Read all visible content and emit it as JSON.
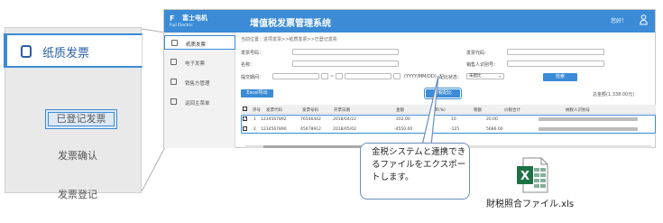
{
  "zoom": {
    "active_label": "纸质发票",
    "sub_items": [
      "已登记发票",
      "发票确认",
      "发票登记"
    ]
  },
  "app": {
    "logo_cn": "富士电机",
    "logo_en": "Fuji Electric",
    "title": "增值税发票管理系统",
    "greeting": "您好！"
  },
  "sidebar": {
    "items": [
      {
        "label": "纸质发票",
        "icon": "document-icon"
      },
      {
        "label": "电子发票",
        "icon": "image-icon"
      },
      {
        "label": "销售方管理",
        "icon": "list-icon"
      },
      {
        "label": "返回主菜单",
        "icon": "home-icon"
      }
    ]
  },
  "breadcrumb": "当前位置：进项发票>>纸质发票>>已登记发票",
  "form": {
    "invoice_no": "发票号码：",
    "invoice_code": "发票代码：",
    "name": "名称：",
    "seller_tax_id": "销售人识别号：",
    "submit_time": "提交期间：",
    "date_format": "(YYYY/MM/DD)",
    "match_status": "配比状态：",
    "match_value": "未配比",
    "date_sep": "~"
  },
  "buttons": {
    "query": "检索",
    "excel": "Excel导出",
    "reconcile": "财税配比"
  },
  "total": "总金额(1,338.00元)",
  "table": {
    "headers": [
      "序号",
      "发票代码",
      "发票号码",
      "开票日期",
      "金额",
      "税率(%)",
      "税额",
      "价税合计",
      "纳税人识别号"
    ],
    "rows": [
      {
        "no": "1",
        "code": "1234567892",
        "number": "76546442",
        "date": "2018/04/22",
        "amount": "202.00",
        "rate": "10",
        "tax": "20.00"
      },
      {
        "no": "2",
        "code": "1234567890",
        "number": "45678912",
        "date": "2018/05/02",
        "amount": "-4550.00",
        "rate": "-125",
        "tax": "5686.00"
      }
    ]
  },
  "callout": "金税システムと連携できるファイルをエクスポートします。",
  "file_name": "財税照合ファイル.xls",
  "colors": {
    "accent": "#3b8bd6",
    "excel_green": "#1e7145"
  }
}
